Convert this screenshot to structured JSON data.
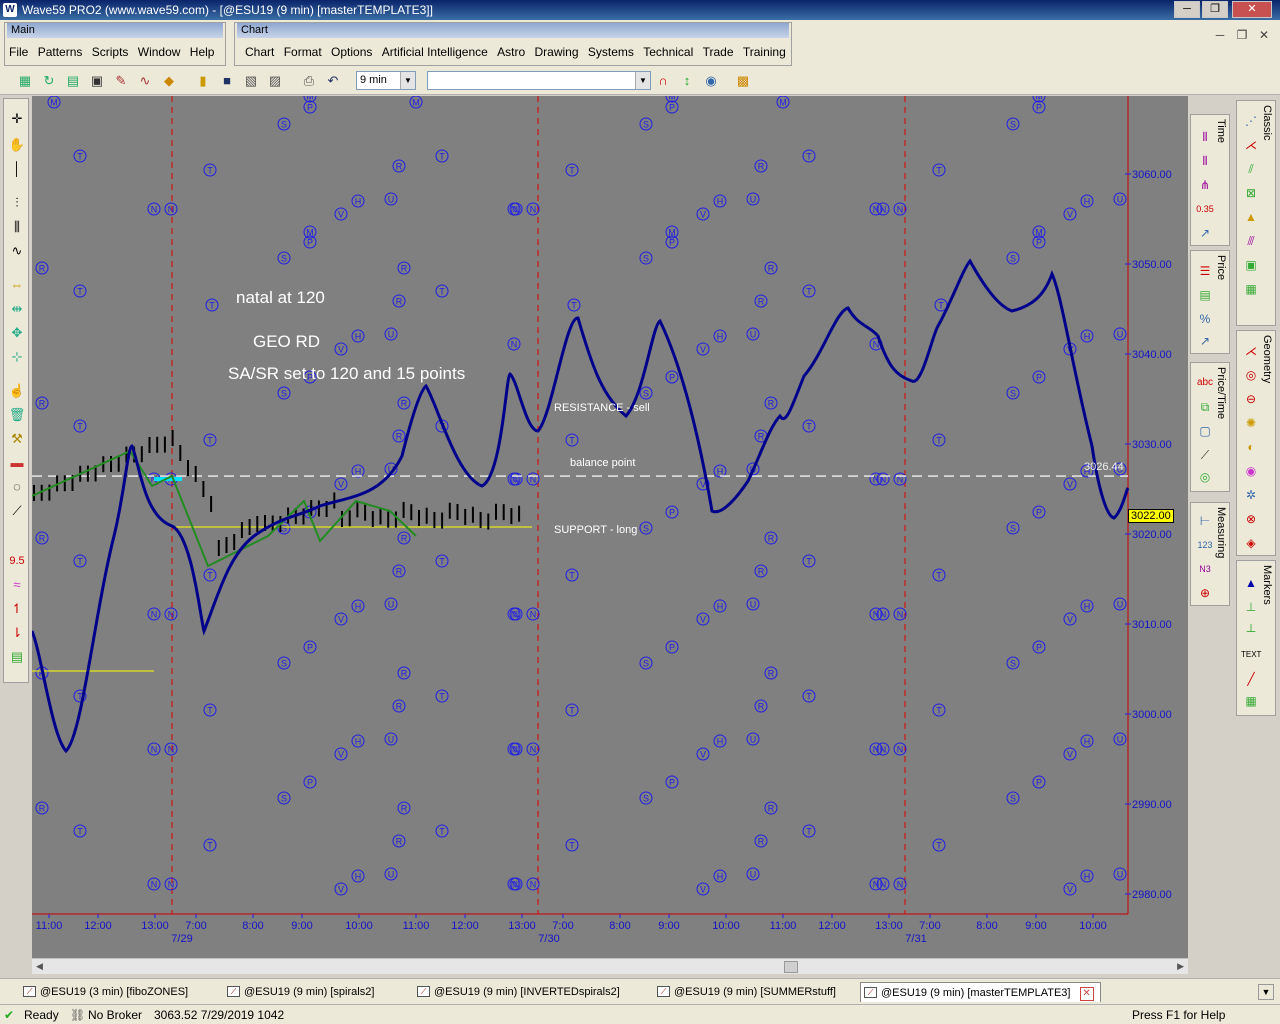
{
  "window": {
    "title": "Wave59 PRO2 (www.wave59.com) - [@ESU19 (9 min) [masterTEMPLATE3]]",
    "minimize": "─",
    "restore": "❐",
    "close": "✕"
  },
  "menus": {
    "main_title": "Main",
    "main_items": [
      "File",
      "Patterns",
      "Scripts",
      "Window",
      "Help"
    ],
    "chart_title": "Chart",
    "chart_items": [
      "Chart",
      "Format",
      "Options",
      "Artificial Intelligence",
      "Astro",
      "Drawing",
      "Systems",
      "Technical",
      "Trade",
      "Training"
    ],
    "mdi_minimize": "─",
    "mdi_restore": "❐",
    "mdi_close": "✕"
  },
  "toolbar": {
    "interval_value": "9 min",
    "symbol_value": ""
  },
  "chart": {
    "annotations": {
      "natal": "natal at 120",
      "geo": "GEO RD",
      "sasr": "SA/SR set to 120 and 15 points",
      "resistance": "RESISTANCE - sell",
      "balance": "balance point",
      "support": "SUPPORT - long"
    },
    "balance_value": "3026.44",
    "current_price": "3022.00",
    "colors": {
      "background": "#808080",
      "price_line": "#00008b",
      "symbols": "#1e1ee6",
      "zigzag": "#228b22",
      "dividers": "#e00000",
      "support": "#ffff00",
      "price_box": "#ffff00"
    }
  },
  "chart_data": {
    "type": "line",
    "y_ticks": [
      "3060.00",
      "3050.00",
      "3040.00",
      "3030.00",
      "3020.00",
      "3010.00",
      "3000.00",
      "2990.00",
      "2980.00"
    ],
    "x_ticks": [
      "11:00",
      "12:00",
      "13:00",
      "7:00",
      "8:00",
      "9:00",
      "10:00",
      "11:00",
      "12:00",
      "13:00",
      "7:00",
      "8:00",
      "9:00",
      "10:00",
      "11:00",
      "12:00",
      "13:00",
      "7:00",
      "8:00",
      "9:00",
      "10:00"
    ],
    "date_labels": [
      "7/29",
      "7/30",
      "7/31"
    ],
    "ylim": [
      2976,
      3069
    ],
    "balance_point": 3026.44,
    "support_level": 3021,
    "current_price": 3022.0
  },
  "right_panels": {
    "time": "Time",
    "price": "Price",
    "price_time": "Price/Time",
    "measuring": "Measuring",
    "classic": "Classic",
    "geometry": "Geometry",
    "markers": "Markers"
  },
  "tabs": [
    {
      "label": "@ESU19 (3 min) [fiboZONES]"
    },
    {
      "label": "@ESU19 (9 min) [spirals2]"
    },
    {
      "label": "@ESU19 (9 min) [INVERTEDspirals2]"
    },
    {
      "label": "@ESU19 (9 min) [SUMMERstuff]"
    },
    {
      "label": "@ESU19 (9 min) [masterTEMPLATE3]"
    }
  ],
  "status": {
    "ready": "Ready",
    "broker": "No Broker",
    "info": "3063.52  7/29/2019  1042",
    "help": "Press F1 for Help"
  }
}
